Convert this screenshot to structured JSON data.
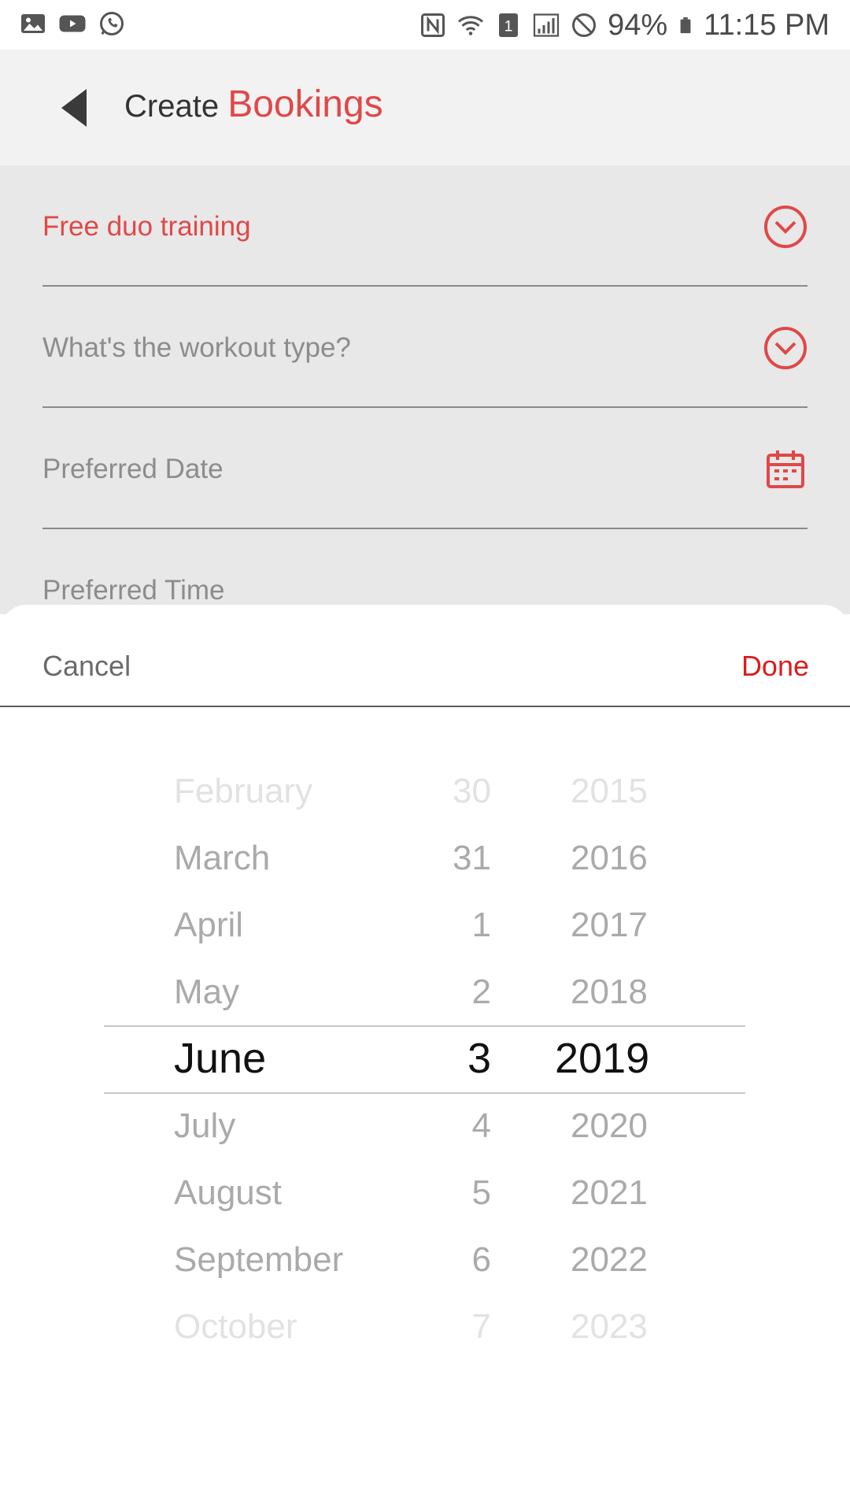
{
  "status_bar": {
    "battery": "94%",
    "time": "11:15 PM",
    "left_icons": [
      "gallery-icon",
      "youtube-icon",
      "whatsapp-icon"
    ],
    "right_icons": [
      "nfc-icon",
      "wifi-icon",
      "sim-icon",
      "signal-icon",
      "dnd-icon",
      "battery-icon"
    ]
  },
  "app_bar": {
    "title_prefix": "Create",
    "title_accent": "Bookings"
  },
  "form": {
    "fields": [
      {
        "label": "Free duo training",
        "icon": "chevron-down-circle-icon"
      },
      {
        "label": "What's the workout type?",
        "icon": "chevron-down-circle-icon"
      },
      {
        "label": "Preferred Date",
        "icon": "calendar-icon"
      },
      {
        "label": "Preferred Time"
      }
    ]
  },
  "sheet": {
    "cancel_label": "Cancel",
    "done_label": "Done"
  },
  "picker": {
    "months": [
      "February",
      "March",
      "April",
      "May",
      "June",
      "July",
      "August",
      "September",
      "October"
    ],
    "days": [
      "30",
      "31",
      "1",
      "2",
      "3",
      "4",
      "5",
      "6",
      "7"
    ],
    "years": [
      "2015",
      "2016",
      "2017",
      "2018",
      "2019",
      "2020",
      "2021",
      "2022",
      "2023"
    ],
    "selected": {
      "month": "June",
      "day": "3",
      "year": "2019"
    }
  },
  "colors": {
    "accent": "#e04848",
    "done": "#d81e1e",
    "form_background": "#e8e8e8",
    "appbar_background": "#f2f2f2"
  }
}
